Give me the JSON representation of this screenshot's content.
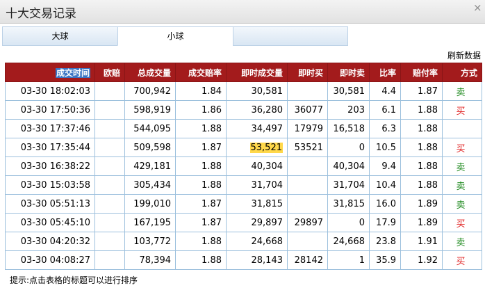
{
  "window": {
    "title": "十大交易记录",
    "close_label": "×"
  },
  "tabs": [
    {
      "label": "大球",
      "active": false
    },
    {
      "label": "小球",
      "active": true
    },
    {
      "label": "",
      "active": false
    }
  ],
  "refresh_label": "刷新数据",
  "table": {
    "headers": [
      "成交时间",
      "欧赔",
      "总成交量",
      "成交赔率",
      "即时成交量",
      "即时买",
      "即时卖",
      "比率",
      "赔付率",
      "方式"
    ],
    "rows": [
      [
        "03-30 18:02:03",
        "",
        "700,942",
        "1.84",
        "30,581",
        "",
        "30,581",
        "4.4",
        "1.87",
        "卖"
      ],
      [
        "03-30 17:50:36",
        "",
        "598,919",
        "1.86",
        "36,280",
        "36077",
        "203",
        "6.1",
        "1.88",
        "买"
      ],
      [
        "03-30 17:37:46",
        "",
        "544,095",
        "1.88",
        "34,497",
        "17979",
        "16,518",
        "6.3",
        "1.88",
        ""
      ],
      [
        "03-30 17:35:44",
        "",
        "509,598",
        "1.87",
        "53,521",
        "53521",
        "0",
        "10.5",
        "1.88",
        "买"
      ],
      [
        "03-30 16:38:22",
        "",
        "429,181",
        "1.88",
        "40,304",
        "",
        "40,304",
        "9.4",
        "1.88",
        "卖"
      ],
      [
        "03-30 15:03:58",
        "",
        "305,434",
        "1.88",
        "31,704",
        "",
        "31,704",
        "10.4",
        "1.88",
        "卖"
      ],
      [
        "03-30 05:51:13",
        "",
        "199,010",
        "1.87",
        "31,815",
        "",
        "31,815",
        "16.0",
        "1.89",
        "卖"
      ],
      [
        "03-30 05:45:10",
        "",
        "167,195",
        "1.87",
        "29,897",
        "29897",
        "0",
        "17.9",
        "1.89",
        "买"
      ],
      [
        "03-30 04:20:32",
        "",
        "103,772",
        "1.88",
        "24,668",
        "",
        "24,668",
        "23.8",
        "1.91",
        "卖"
      ],
      [
        "03-30 04:08:27",
        "",
        "78,394",
        "1.88",
        "28,143",
        "28142",
        "1",
        "35.9",
        "1.92",
        "买"
      ]
    ],
    "highlighted_cell": {
      "row": 3,
      "col": 4,
      "color": "#ffd84a"
    }
  },
  "colors": {
    "header_bg": "#a31b1c",
    "sell": "#1f8a1f",
    "buy": "#e02020",
    "border": "#9cc0dd"
  },
  "tip": "提示:点击表格的标题可以进行排序"
}
